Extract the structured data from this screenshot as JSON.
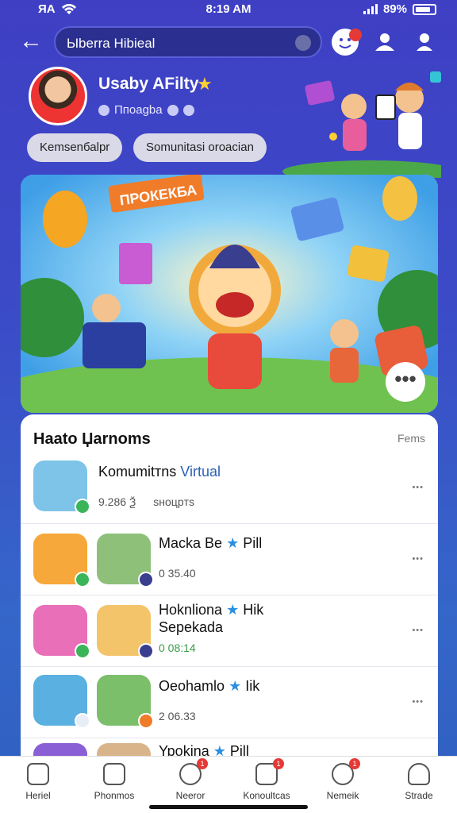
{
  "status_bar": {
    "carrier": "ЯА",
    "time": "8:19 AM",
    "battery": "89%"
  },
  "header": {
    "back_label": "←",
    "search_value": "Ыberra Hibieal",
    "badge_count": ""
  },
  "profile": {
    "name": "Usaby AFilty",
    "subtitle": "Ппоagba",
    "chips": [
      "Kemsenбаlpr",
      "Somunitasi oroacian"
    ]
  },
  "banner": {
    "sign_text": "ПРОКЕКБА",
    "more_label": "•••"
  },
  "list": {
    "title": "Haato Џarnoms",
    "more": "Fems",
    "rows": [
      {
        "name": "Komumitтns",
        "name_accent": "Virtual",
        "sub": "9.286 Ѯ",
        "sub2": "sноцpтs",
        "meta": "•••"
      },
      {
        "name": "Macka Be",
        "star": "★",
        "name_tail": "Pill",
        "sub": "0 35.40",
        "meta": "•••"
      },
      {
        "name": "Hoknliona",
        "star": "★",
        "name_tail": "Hik",
        "name_line2": "Sepekada",
        "sub": "0 08:14",
        "meta": "•••"
      },
      {
        "name": "Oeohamlo",
        "star": "★",
        "name_tail": "Iik",
        "sub": "2 06.33",
        "meta": "•••"
      },
      {
        "name": "Ypokina",
        "star": "★",
        "name_tail": "Pill",
        "sub": "",
        "meta": ""
      }
    ]
  },
  "bottom_nav": [
    {
      "label": "Heriel",
      "icon": "home-icon"
    },
    {
      "label": "Phonmos",
      "icon": "shop-icon"
    },
    {
      "label": "Neeror",
      "icon": "clock-icon",
      "badge": "1"
    },
    {
      "label": "Konoultcas",
      "icon": "book-icon",
      "badge": "1"
    },
    {
      "label": "Nemeik",
      "icon": "chat-icon",
      "badge": "1"
    },
    {
      "label": "Strade",
      "icon": "profile-icon"
    }
  ],
  "colors": {
    "accent": "#3f3fc4",
    "star": "#2a8fe0",
    "badge": "#e53935"
  }
}
